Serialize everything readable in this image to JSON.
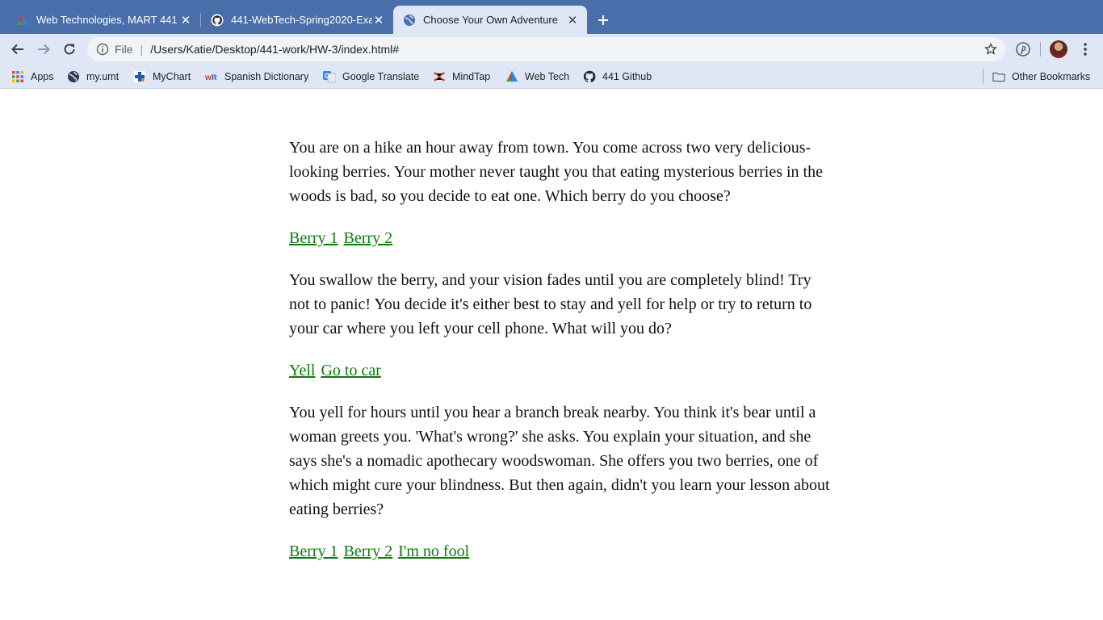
{
  "browser": {
    "tabs": [
      {
        "title": "Web Technologies, MART 441 |",
        "favicon": "colorful-triangle-icon",
        "active": false
      },
      {
        "title": "441-WebTech-Spring2020-Exa",
        "favicon": "github-icon",
        "active": false
      },
      {
        "title": "Choose Your Own Adventure",
        "favicon": "globe-icon",
        "active": true
      }
    ],
    "new_tab_icon": "plus-icon",
    "address": {
      "scheme_label": "File",
      "url": "/Users/Katie/Desktop/441-work/HW-3/index.html#"
    },
    "bookmarks": [
      {
        "label": "Apps",
        "icon": "apps-grid-icon"
      },
      {
        "label": "my.umt",
        "icon": "globe-icon"
      },
      {
        "label": "MyChart",
        "icon": "mychart-cross-icon"
      },
      {
        "label": "Spanish Dictionary",
        "icon": "wordreference-icon"
      },
      {
        "label": "Google Translate",
        "icon": "google-translate-icon"
      },
      {
        "label": "MindTap",
        "icon": "mindtap-icon"
      },
      {
        "label": "Web Tech",
        "icon": "colorful-triangle-icon"
      },
      {
        "label": "441 Github",
        "icon": "github-icon"
      }
    ],
    "other_bookmarks": "Other Bookmarks",
    "accent_color": "#4a6ea9"
  },
  "story": [
    {
      "text": "You are on a hike an hour away from town. You come across two very delicious-looking berries. Your mother never taught you that eating mysterious berries in the woods is bad, so you decide to eat one. Which berry do you choose?",
      "choices": [
        "Berry 1",
        "Berry 2"
      ]
    },
    {
      "text": "You swallow the berry, and your vision fades until you are completely blind! Try not to panic! You decide it's either best to stay and yell for help or try to return to your car where you left your cell phone. What will you do?",
      "choices": [
        "Yell",
        "Go to car"
      ]
    },
    {
      "text": "You yell for hours until you hear a branch break nearby. You think it's bear until a woman greets you. 'What's wrong?' she asks. You explain your situation, and she says she's a nomadic apothecary woodswoman. She offers you two berries, one of which might cure your blindness. But then again, didn't you learn your lesson about eating berries?",
      "choices": [
        "Berry 1",
        "Berry 2",
        "I'm no fool"
      ]
    }
  ],
  "link_color": "#0e7a0e"
}
